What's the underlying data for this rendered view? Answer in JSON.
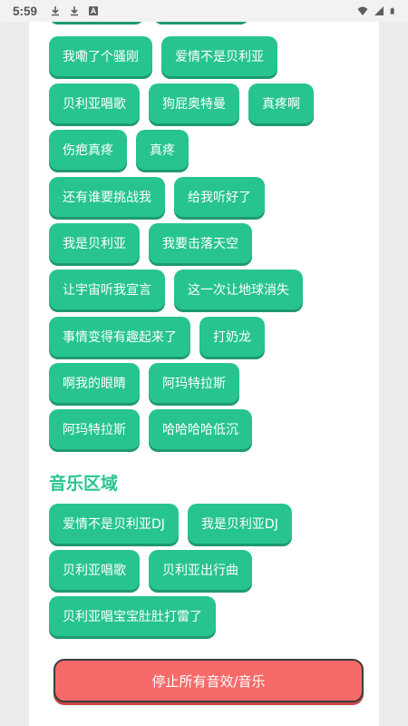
{
  "status_bar": {
    "time": "5:59",
    "left_icons": [
      "download-icon",
      "download-icon",
      "font-icon"
    ],
    "right_icons": [
      "wifi-icon",
      "signal-icon",
      "battery-icon"
    ]
  },
  "sound_rows": [
    [
      "我嘞了个骚刚",
      "爱情不是贝利亚"
    ],
    [
      "贝利亚唱歌",
      "狗屁奥特曼",
      "真疼啊"
    ],
    [
      "伤疤真疼",
      "真疼"
    ],
    [
      "还有谁要挑战我",
      "给我听好了"
    ],
    [
      "我是贝利亚",
      "我要击落天空"
    ],
    [
      "让宇宙听我宣言",
      "这一次让地球消失"
    ],
    [
      "事情变得有趣起来了",
      "打奶龙"
    ],
    [
      "啊我的眼睛",
      "阿玛特拉斯"
    ],
    [
      "阿玛特拉斯",
      "哈哈哈哈低沉"
    ]
  ],
  "music_section": {
    "title": "音乐区域",
    "rows": [
      [
        "爱情不是贝利亚DJ",
        "我是贝利亚DJ"
      ],
      [
        "贝利亚唱歌",
        "贝利亚出行曲"
      ],
      [
        "贝利亚唱宝宝肚肚打雷了"
      ]
    ]
  },
  "stop_button": {
    "label": "停止所有音效/音乐"
  },
  "colors": {
    "accent": "#27c48e",
    "accent_shadow": "#1e9a6f",
    "stop": "#f76a6a"
  }
}
